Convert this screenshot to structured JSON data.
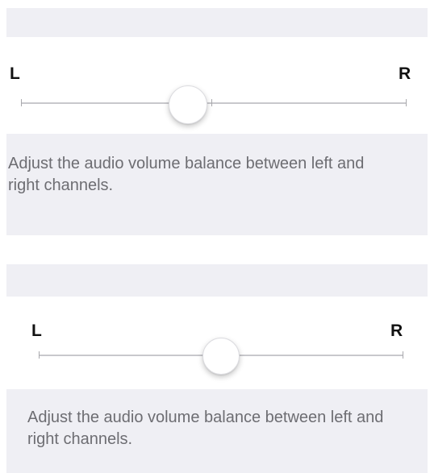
{
  "balance_panels": [
    {
      "left_label": "L",
      "right_label": "R",
      "balance_fraction": 0.44,
      "footer": "Adjust the audio volume balance between left and right channels."
    },
    {
      "left_label": "L",
      "right_label": "R",
      "balance_fraction": 0.5,
      "footer": "Adjust the audio volume balance between left and right channels."
    }
  ],
  "colors": {
    "group_background": "#efeff4",
    "cell_background": "#ffffff",
    "track": "#c8c8cc",
    "footer_text": "#6d6d72"
  }
}
